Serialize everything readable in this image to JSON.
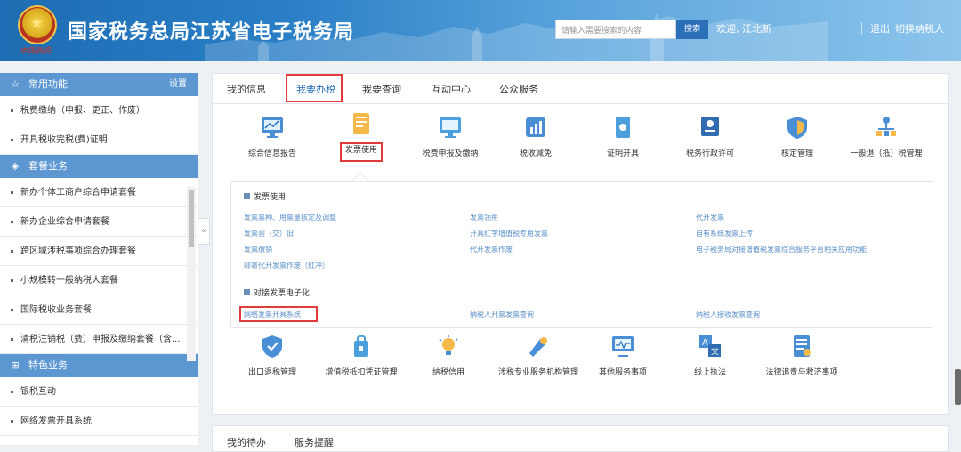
{
  "header": {
    "title": "国家税务总局江苏省电子税务局",
    "emblem_text": "中国税务",
    "search_placeholder": "请输入需要搜索的内容",
    "search_button": "搜索",
    "welcome": "欢迎, 江北新",
    "logout": "退出",
    "switch_taxpayer": "切换纳税人"
  },
  "sidebar": {
    "common": {
      "title": "常用功能",
      "settings": "设置",
      "items": [
        "税费缴纳（申报、更正、作废）",
        "开具税收完税(费)证明"
      ]
    },
    "package": {
      "title": "套餐业务",
      "items": [
        "新办个体工商户综合申请套餐",
        "新办企业综合申请套餐",
        "跨区域涉税事项综合办理套餐",
        "小规模转一般纳税人套餐",
        "国际税收业务套餐",
        "清税注销税（费）申报及缴纳套餐（含..."
      ]
    },
    "special": {
      "title": "特色业务",
      "items": [
        "银税互动",
        "网络发票开具系统"
      ]
    }
  },
  "tabs": [
    "我的信息",
    "我要办税",
    "我要查询",
    "互动中心",
    "公众服务"
  ],
  "icons_row1": [
    "综合信息报告",
    "发票使用",
    "税费申报及缴纳",
    "税收减免",
    "证明开具",
    "税务行政许可",
    "核定管理",
    "一般退（抵）税管理"
  ],
  "invoice_section": {
    "title": "发票使用",
    "links_col1": [
      "发票票种、用票量核定及调整",
      "发票验（交）旧",
      "发票缴销",
      "邮寄代开发票作废（红冲）"
    ],
    "links_col2": [
      "发票领用",
      "开具红字增值税专用发票",
      "代开发票作废"
    ],
    "links_col3": [
      "代开发票",
      "自有系统发票上传",
      "电子税务局对接增值税发票综合服务平台相关应用功能"
    ]
  },
  "e_invoice_section": {
    "title": "对接发票电子化",
    "links": [
      "网络发票开具系统",
      "纳税人开票发票查询",
      "纳税人接收发票查询"
    ]
  },
  "icons_row2": [
    "出口退税管理",
    "增值税抵扣凭证管理",
    "纳税信用",
    "涉税专业服务机构管理",
    "其他服务事项",
    "线上执法",
    "法律追责与救济事项"
  ],
  "bottom_tabs": [
    "我的待办",
    "服务提醒"
  ],
  "colors": {
    "accent": "#2a6fb8",
    "highlight": "#e23b3b",
    "sidebar_head": "#5d97d2",
    "link": "#5a8fc8"
  }
}
